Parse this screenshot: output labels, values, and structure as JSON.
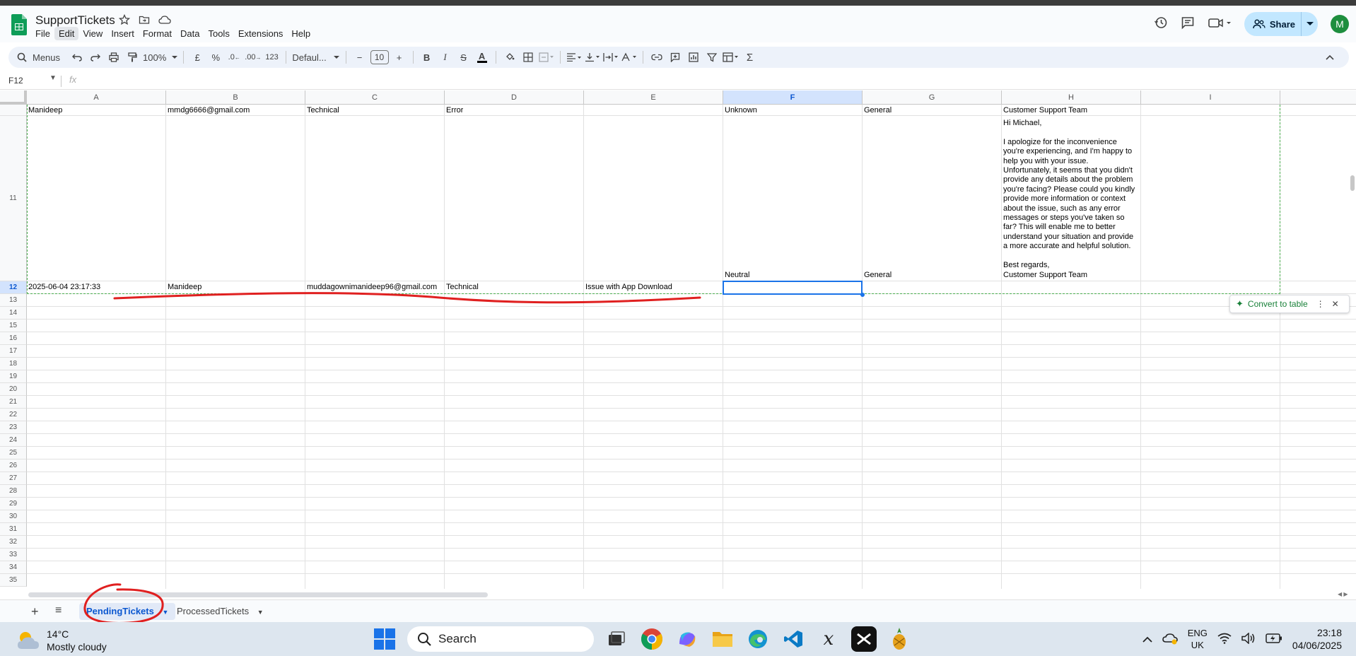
{
  "app": {
    "title": "SupportTickets",
    "menu": [
      "File",
      "Edit",
      "View",
      "Insert",
      "Format",
      "Data",
      "Tools",
      "Extensions",
      "Help"
    ],
    "active_menu": "Edit",
    "share_label": "Share",
    "avatar_letter": "M",
    "brand_color": "#0f9d58"
  },
  "toolbar": {
    "search_label": "Menus",
    "zoom": "100%",
    "currency": "£",
    "percent": "%",
    "dec_less": ".0",
    "dec_more": ".00",
    "number_format": "123",
    "font": "Defaul...",
    "font_size": "10"
  },
  "formula": {
    "cell_ref": "F12",
    "fx": "fx"
  },
  "columns": [
    "A",
    "B",
    "C",
    "D",
    "E",
    "F",
    "G",
    "H",
    "I"
  ],
  "rows": [
    "11",
    "12",
    "13",
    "14",
    "15",
    "16",
    "17",
    "18",
    "19",
    "20",
    "21",
    "22",
    "23",
    "24",
    "25",
    "26",
    "27",
    "28",
    "29",
    "30",
    "31",
    "32",
    "33",
    "34",
    "35"
  ],
  "cells": {
    "r10": {
      "a": "Manideep",
      "b": "mmdg6666@gmail.com",
      "c": "Technical",
      "d": "Error",
      "f": "Unknown",
      "g": "General",
      "h": "Customer Support Team"
    },
    "r11": {
      "f": "Neutral",
      "g": "General",
      "h": "Hi Michael,\n\nI apologize for the inconvenience\nyou're experiencing, and I'm happy to\nhelp you with your issue.\nUnfortunately, it seems that you didn't\nprovide any details about the problem\nyou're facing? Please could you kindly\nprovide more information or context\nabout the issue, such as any error\nmessages or steps you've taken so\nfar? This will enable me to better\nunderstand your situation and provide\na more accurate and helpful solution.\n\nBest regards,\nCustomer Support Team"
    },
    "r12": {
      "a": "2025-06-04 23:17:33",
      "b": "Manideep",
      "c": "muddagownimanideep96@gmail.com",
      "d": "Technical",
      "e": "Issue with App Download"
    }
  },
  "convert_chip": "Convert to table",
  "sheets": {
    "tabs": [
      "PendingTickets",
      "ProcessedTickets"
    ],
    "active": "PendingTickets"
  },
  "taskbar": {
    "temperature": "14°C",
    "weather": "Mostly cloudy",
    "search": "Search",
    "lang_top": "ENG",
    "lang_bottom": "UK",
    "time": "23:18",
    "date": "04/06/2025"
  }
}
